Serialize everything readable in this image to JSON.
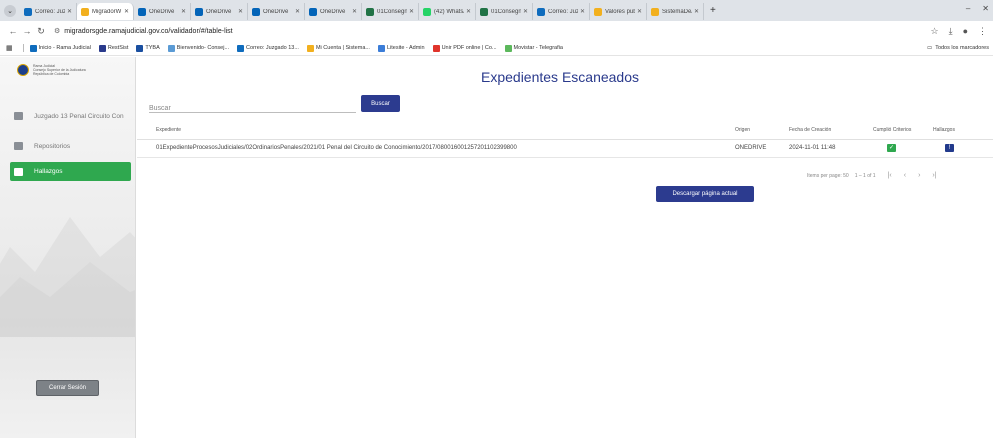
{
  "browser": {
    "tabs": [
      {
        "title": "Correo: Juzg",
        "color": "#0f6cbd",
        "active": false
      },
      {
        "title": "MigradorW",
        "color": "#f2b01e",
        "active": true
      },
      {
        "title": "OneDrive",
        "color": "#0364b8",
        "active": false
      },
      {
        "title": "OneDrive",
        "color": "#0364b8",
        "active": false
      },
      {
        "title": "OneDrive",
        "color": "#0364b8",
        "active": false
      },
      {
        "title": "OneDrive",
        "color": "#0364b8",
        "active": false
      },
      {
        "title": "01Consegn",
        "color": "#217346",
        "active": false
      },
      {
        "title": "(42) WhatsA",
        "color": "#25d366",
        "active": false
      },
      {
        "title": "01Consegn",
        "color": "#217346",
        "active": false
      },
      {
        "title": "Correo: Juzg",
        "color": "#0f6cbd",
        "active": false
      },
      {
        "title": "Valores publi",
        "color": "#f2b01e",
        "active": false
      },
      {
        "title": "SistemaDeA",
        "color": "#f2b01e",
        "active": false
      }
    ],
    "new_tab": "+",
    "url": "migradorsgde.ramajudicial.gov.co/validador/#/table-list",
    "bookmarks": [
      {
        "label": "Inicio - Rama Judicial",
        "color": "#0f6cbd"
      },
      {
        "label": "RestSist",
        "color": "#2a3a8c"
      },
      {
        "label": "TYBA",
        "color": "#1a4fa0"
      },
      {
        "label": "Bienvenido- Consej...",
        "color": "#5b9bd5"
      },
      {
        "label": "Correo: Juzgado 13...",
        "color": "#0f6cbd"
      },
      {
        "label": "Mi Cuenta | Sistema...",
        "color": "#f2b01e"
      },
      {
        "label": "Litesite - Admin",
        "color": "#3b7dd8"
      },
      {
        "label": "Unir PDF online | Co...",
        "color": "#e0342b"
      },
      {
        "label": "Movistar - Telegrafia",
        "color": "#5cb85c"
      }
    ],
    "all_bookmarks": "Todos los marcadores"
  },
  "sidebar": {
    "logo_lines": [
      "Rama Judicial",
      "Consejo Superior de la Judicatura",
      "República de Colombia"
    ],
    "items": [
      {
        "label": "Juzgado 13 Penal Circuito Con",
        "icon": "building-icon",
        "active": false
      },
      {
        "label": "Repositorios",
        "icon": "grid-icon",
        "active": false
      },
      {
        "label": "Hallazgos",
        "icon": "monitor-icon",
        "active": true
      }
    ],
    "logout_label": "Cerrar Sesión"
  },
  "main": {
    "title": "Expedientes Escaneados",
    "search": {
      "placeholder": "Buscar",
      "value": ""
    },
    "search_button": "Buscar",
    "table": {
      "headers": [
        "Expediente",
        "Origen",
        "Fecha de Creación",
        "Cumplió Criterios",
        "Hallazgos"
      ],
      "rows": [
        {
          "expediente": "01ExpedienteProcesosJudiciales/02OrdinariosPenales/2021/01 Penal del Circuito de Conocimiento/2017/080016001257201102399800",
          "origen": "ONEDRIVE",
          "fecha": "2024-11-01 11:48",
          "cumplio": true,
          "hallazgos": true
        }
      ]
    },
    "pager": {
      "items_per_page": "Items per page: 50",
      "range": "1 – 1 of 1"
    },
    "download_button": "Descargar página actual"
  }
}
